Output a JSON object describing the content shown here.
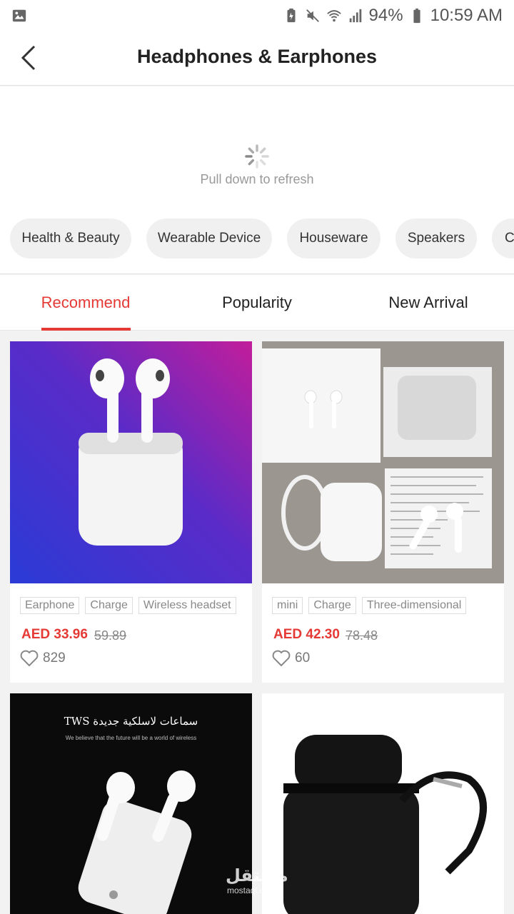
{
  "status_bar": {
    "battery": "94%",
    "time": "10:59 AM",
    "icons": [
      "image-icon",
      "battery-saver-icon",
      "mute-icon",
      "wifi-icon",
      "signal-icon",
      "battery-icon"
    ]
  },
  "header": {
    "title": "Headphones & Earphones",
    "back_icon": "chevron-left-icon"
  },
  "refresh": {
    "text": "Pull down to refresh"
  },
  "categories": [
    "Health & Beauty",
    "Wearable Device",
    "Houseware",
    "Speakers",
    "C"
  ],
  "tabs": [
    {
      "label": "Recommend",
      "active": true
    },
    {
      "label": "Popularity",
      "active": false
    },
    {
      "label": "New Arrival",
      "active": false
    }
  ],
  "products": [
    {
      "tags": [
        "Earphone",
        "Charge",
        "Wireless headset"
      ],
      "price": "AED 33.96",
      "old_price": "59.89",
      "likes": "829"
    },
    {
      "tags": [
        "mini",
        "Charge",
        "Three-dimensional"
      ],
      "price": "AED 42.30",
      "old_price": "78.48",
      "likes": "60"
    },
    {
      "banner_text": "TWS سماعات لاسلكية جديدة",
      "banner_sub": "We believe that the future will be a world of wireless"
    },
    {}
  ],
  "watermark": {
    "text": "مستقل",
    "sub": "mostaql.com"
  },
  "colors": {
    "accent": "#e53935",
    "background": "#f2f2f2"
  }
}
